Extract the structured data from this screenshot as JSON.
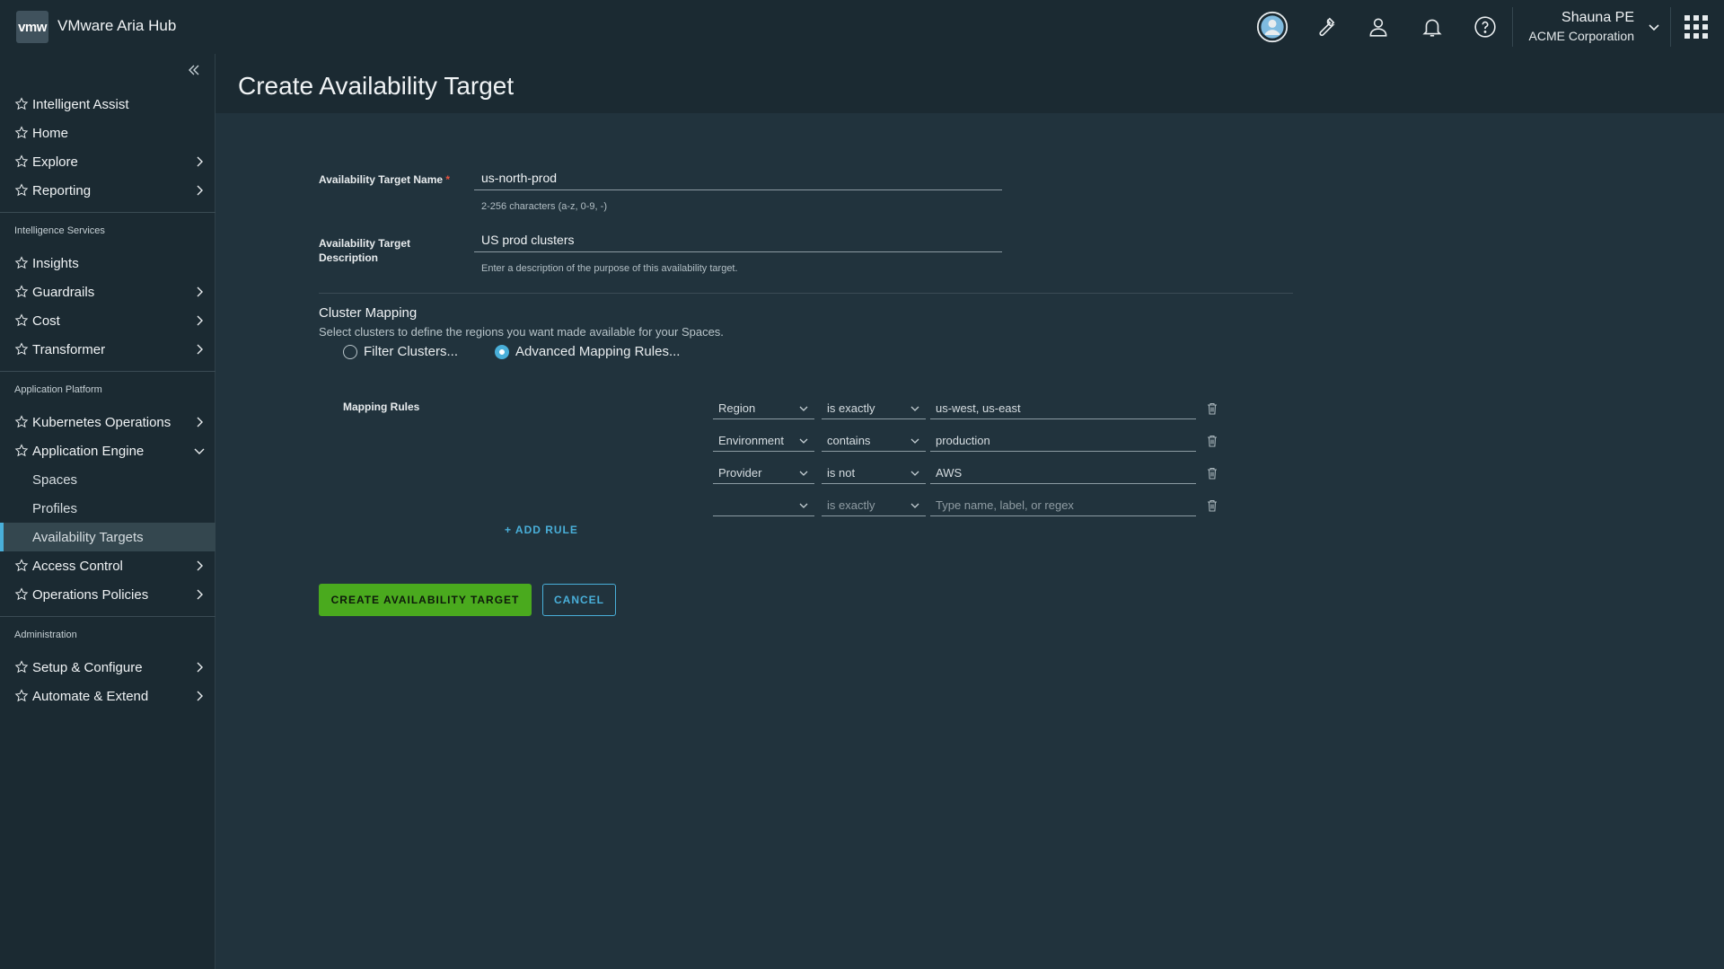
{
  "header": {
    "logo_text": "vmw",
    "app_title": "VMware Aria Hub",
    "user_name": "Shauna PE",
    "user_org": "ACME Corporation",
    "icons": [
      "avatar-icon",
      "wrench-icon",
      "user-icon",
      "bell-icon",
      "help-icon",
      "app-grid-icon"
    ]
  },
  "sidebar": {
    "top_items": [
      {
        "label": "Intelligent Assist"
      },
      {
        "label": "Home"
      },
      {
        "label": "Explore"
      },
      {
        "label": "Reporting"
      }
    ],
    "intelligence_label": "Intelligence Services",
    "intelligence_items": [
      {
        "label": "Insights"
      },
      {
        "label": "Guardrails"
      },
      {
        "label": "Cost"
      },
      {
        "label": "Transformer"
      }
    ],
    "platform_label": "Application Platform",
    "platform_items": [
      {
        "label": "Kubernetes Operations"
      },
      {
        "label": "Application Engine"
      }
    ],
    "engine_subitems": [
      {
        "label": "Spaces"
      },
      {
        "label": "Profiles"
      },
      {
        "label": "Availability Targets"
      }
    ],
    "platform_items_after": [
      {
        "label": "Access Control"
      },
      {
        "label": "Operations Policies"
      }
    ],
    "admin_label": "Administration",
    "admin_items": [
      {
        "label": "Setup & Configure"
      },
      {
        "label": "Automate & Extend"
      }
    ]
  },
  "page": {
    "title": "Create Availability Target",
    "name_label": "Availability Target Name",
    "required_mark": "*",
    "name_value": "us-north-prod",
    "name_helper": "2-256 characters (a-z, 0-9, -)",
    "desc_label_line1": "Availability Target",
    "desc_label_line2": "Description",
    "desc_value": "US prod clusters",
    "desc_helper": "Enter a description of the purpose of this availability target.",
    "cluster_title": "Cluster Mapping",
    "cluster_desc": "Select clusters to define the regions you want made available for your Spaces.",
    "radio_filter": "Filter Clusters...",
    "radio_advanced": "Advanced Mapping Rules...",
    "selected_radio": "advanced",
    "mapping_label": "Mapping Rules",
    "rules": [
      {
        "field": "Region",
        "op": "is exactly",
        "value": "us-west, us-east"
      },
      {
        "field": "Environment",
        "op": "contains",
        "value": "production"
      },
      {
        "field": "Provider",
        "op": "is not",
        "value": "AWS"
      },
      {
        "field": "",
        "op": "is exactly",
        "value": ""
      }
    ],
    "rule_placeholder": "Type name, label, or regex",
    "add_rule": "+ ADD RULE",
    "create_button": "CREATE AVAILABILITY TARGET",
    "cancel_button": "CANCEL"
  }
}
